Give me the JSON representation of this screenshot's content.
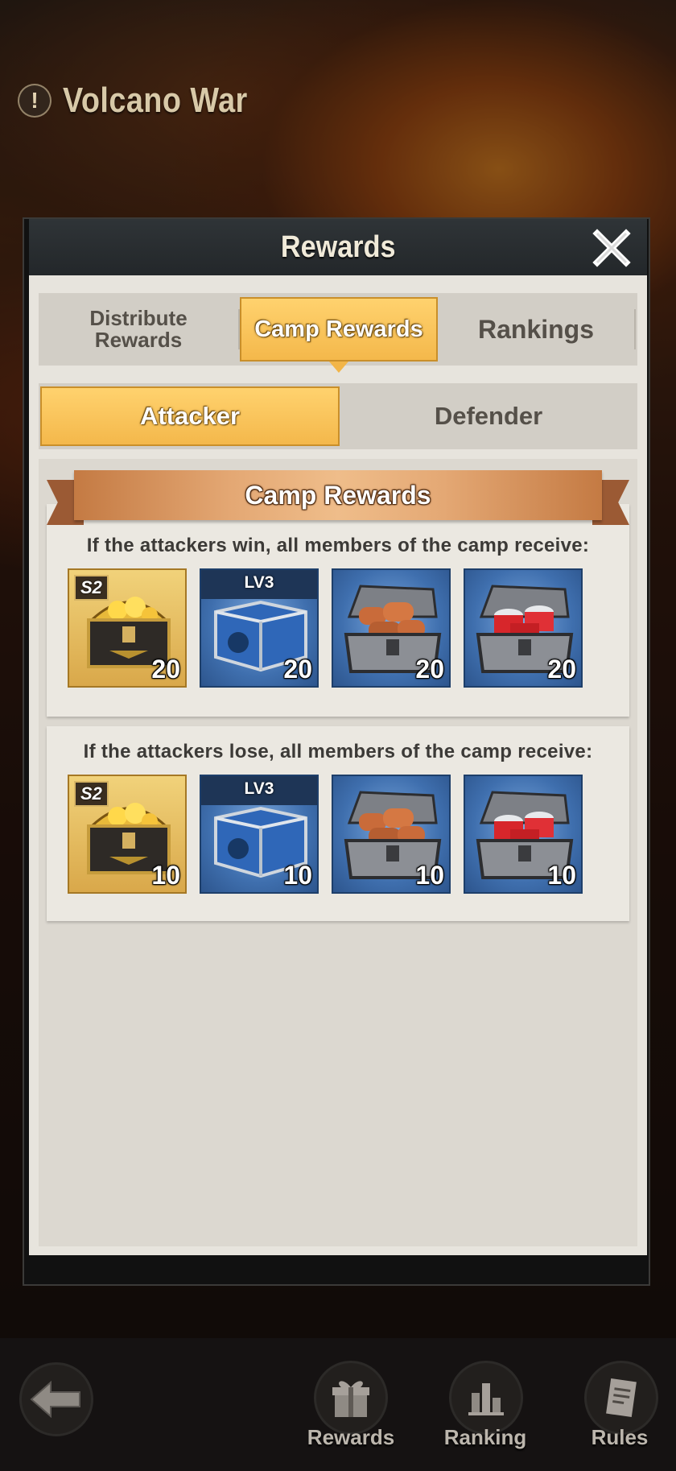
{
  "event": {
    "title": "Volcano War",
    "alert_symbol": "!"
  },
  "modal": {
    "title": "Rewards",
    "close_icon": "close-icon"
  },
  "tabs": [
    {
      "label": "Distribute\nRewards",
      "selected": false
    },
    {
      "label": "Camp Rewards",
      "selected": true
    },
    {
      "label": "Rankings",
      "selected": false
    }
  ],
  "subtabs": [
    {
      "label": "Attacker",
      "selected": true
    },
    {
      "label": "Defender",
      "selected": false
    }
  ],
  "camp_rewards": {
    "title": "Camp Rewards",
    "win": {
      "text": "If the attackers win, all members of the camp receive:",
      "items": [
        {
          "icon": "gold-chest-icon",
          "badge": "S2",
          "quantity": "20"
        },
        {
          "icon": "blue-supply-crate-icon",
          "badge": "LV3",
          "quantity": "20"
        },
        {
          "icon": "wood-chest-icon",
          "badge": "",
          "quantity": "20"
        },
        {
          "icon": "food-can-chest-icon",
          "badge": "",
          "quantity": "20"
        }
      ]
    },
    "lose": {
      "text": "If the attackers lose, all members of the camp receive:",
      "items": [
        {
          "icon": "gold-chest-icon",
          "badge": "S2",
          "quantity": "10"
        },
        {
          "icon": "blue-supply-crate-icon",
          "badge": "LV3",
          "quantity": "10"
        },
        {
          "icon": "wood-chest-icon",
          "badge": "",
          "quantity": "10"
        },
        {
          "icon": "food-can-chest-icon",
          "badge": "",
          "quantity": "10"
        }
      ]
    }
  },
  "bottom_nav": {
    "back_icon": "back-arrow-icon",
    "rewards": "Rewards",
    "ranking": "Ranking",
    "rules": "Rules"
  },
  "colors": {
    "accent_tab": "#f4b84b",
    "panel": "#e7e4dd",
    "ribbon": "#e4a874",
    "item_blue": "#3f6fae",
    "item_gold": "#d9a84a"
  }
}
